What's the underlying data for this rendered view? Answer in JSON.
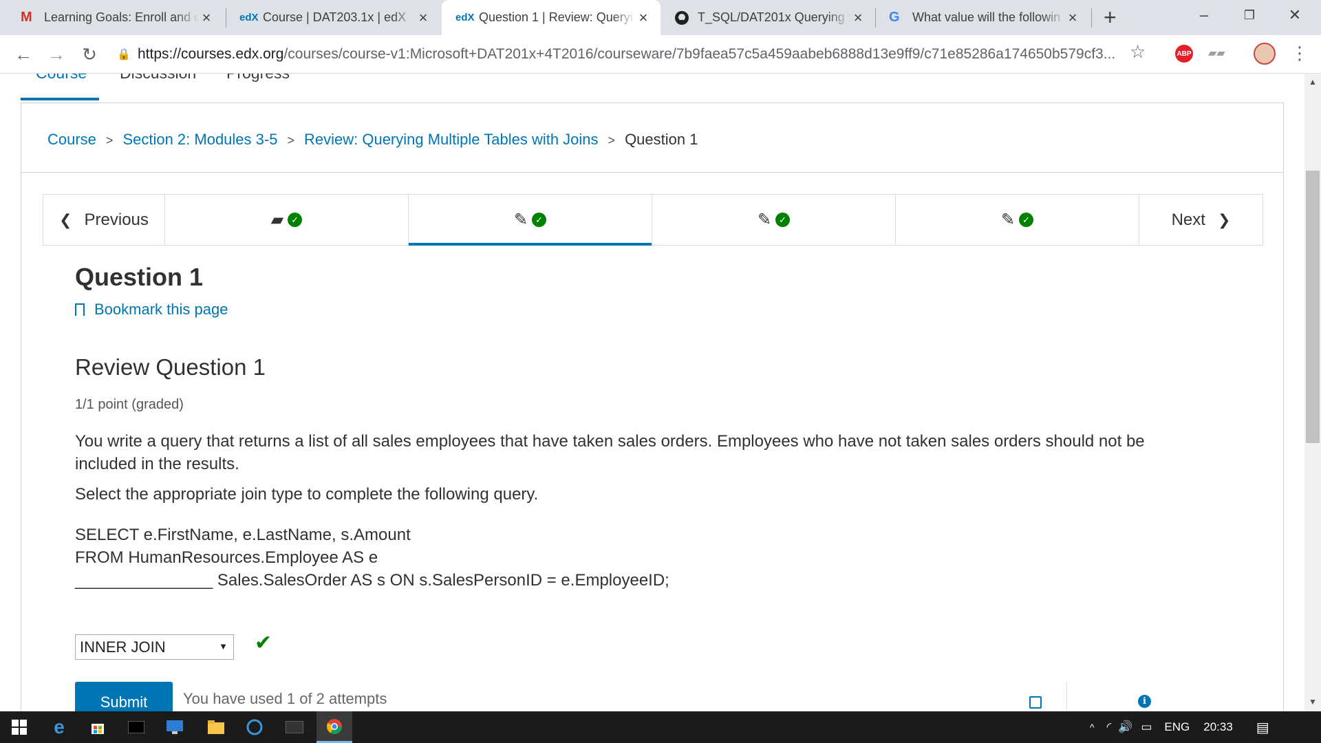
{
  "browser": {
    "tabs": [
      {
        "favicon": "M",
        "favicon_color": "#d93025",
        "title": "Learning Goals: Enroll and c",
        "active": false
      },
      {
        "favicon": "edX",
        "favicon_color": "#0075b4",
        "title": "Course | DAT203.1x | edX",
        "active": false
      },
      {
        "favicon": "edX",
        "favicon_color": "#0075b4",
        "title": "Question 1 | Review: Queryi",
        "active": true
      },
      {
        "favicon": "github",
        "favicon_color": "#202124",
        "title": "T_SQL/DAT201x Querying w",
        "active": false
      },
      {
        "favicon": "G",
        "favicon_color": "#4285f4",
        "title": "What value will the followin",
        "active": false
      }
    ],
    "new_tab": "+",
    "url_host": "https://courses.edx.org",
    "url_path": "/courses/course-v1:Microsoft+DAT201x+4T2016/courseware/7b9faea57c5a459aabeb6888d13e9ff9/c71e85286a174650b579cf3...",
    "abp_label": "ABP"
  },
  "course_nav": {
    "items": [
      "Course",
      "Discussion",
      "Progress"
    ]
  },
  "breadcrumbs": {
    "items": [
      "Course",
      "Section 2: Modules 3-5",
      "Review: Querying Multiple Tables with Joins"
    ],
    "current": "Question 1"
  },
  "sequence_nav": {
    "previous": "Previous",
    "next": "Next",
    "units": [
      {
        "icon": "book-icon",
        "complete": true,
        "active": false
      },
      {
        "icon": "edit-icon",
        "complete": true,
        "active": true
      },
      {
        "icon": "edit-icon",
        "complete": true,
        "active": false
      },
      {
        "icon": "edit-icon",
        "complete": true,
        "active": false
      }
    ]
  },
  "page": {
    "title": "Question 1",
    "bookmark": "Bookmark this page"
  },
  "problem": {
    "title": "Review Question 1",
    "points": "1/1 point (graded)",
    "prompt": "You write a query that returns a list of all sales employees that have taken sales orders. Employees who have not taken sales orders should not be included in the results.",
    "instruction": "Select the appropriate join type to complete the following query.",
    "sql_line1": "SELECT e.FirstName, e.LastName, s.Amount",
    "sql_line2": "FROM HumanResources.Employee AS e",
    "sql_line3": "_______________ Sales.SalesOrder AS s ON s.SalesPersonID = e.EmployeeID;",
    "selected_answer": "INNER JOIN",
    "answer_status": "correct",
    "submit_label": "Submit",
    "attempts_text": "You have used 1 of 2 attempts"
  },
  "taskbar": {
    "language": "ENG",
    "time": "20:33"
  }
}
